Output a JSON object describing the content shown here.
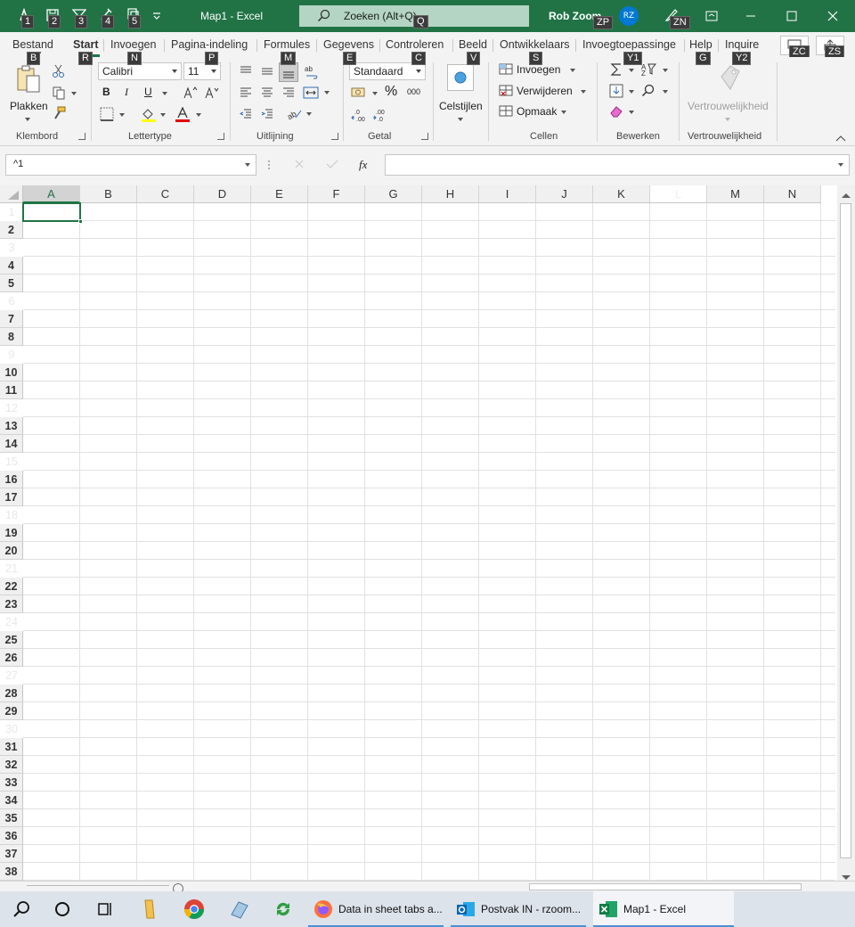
{
  "window": {
    "title": "Map1  -  Excel",
    "search_placeholder": "Zoeken (Alt+Q)",
    "user_name": "Rob Zoom",
    "avatar_initials": "RZ"
  },
  "keytips": {
    "qat": [
      "1",
      "2",
      "3",
      "4",
      "5"
    ],
    "search": "Q",
    "user": "ZP",
    "share": "ZN",
    "tabs": {
      "bestand": "B",
      "start": "R",
      "invoegen": "N",
      "pagina": "P",
      "formules": "M",
      "gegevens": "E",
      "controleren": "C",
      "beeld": "V",
      "ontwikkelaars": "S",
      "invoegtoepassingen": "Y1",
      "help": "G",
      "inquire": "Y2"
    },
    "right": [
      "ZC",
      "ZS"
    ]
  },
  "tabs": [
    "Bestand",
    "Start",
    "Invoegen",
    "Pagina-indeling",
    "Formules",
    "Gegevens",
    "Controleren",
    "Beeld",
    "Ontwikkelaars",
    "Invoegtoepassinge",
    "Help",
    "Inquire"
  ],
  "ribbon": {
    "clipboard": {
      "paste": "Plakken",
      "label": "Klembord"
    },
    "font": {
      "name": "Calibri",
      "size": "11",
      "bold": "B",
      "italic": "I",
      "underline": "U",
      "label": "Lettertype"
    },
    "alignment": {
      "label": "Uitlijning"
    },
    "number": {
      "format": "Standaard",
      "percent": "%",
      "thousands": "000",
      "label": "Getal"
    },
    "styles": {
      "cell_styles": "Celstijlen"
    },
    "cells": {
      "insert": "Invoegen",
      "delete": "Verwijderen",
      "format": "Opmaak",
      "label": "Cellen"
    },
    "editing": {
      "label": "Bewerken"
    },
    "sensitivity": {
      "button": "Vertrouwelijkheid",
      "label": "Vertrouwelijkheid"
    }
  },
  "formula_bar": {
    "name_box": "^1",
    "fx": "fx"
  },
  "grid": {
    "columns": [
      "A",
      "B",
      "C",
      "D",
      "E",
      "F",
      "G",
      "H",
      "I",
      "J",
      "K",
      "L",
      "M",
      "N"
    ],
    "selected_column": "A",
    "rows": [
      "1",
      "2",
      "3",
      "4",
      "5",
      "6",
      "7",
      "8",
      "9",
      "10",
      "11",
      "12",
      "13",
      "14",
      "15",
      "16",
      "17",
      "18",
      "19",
      "20",
      "21",
      "22",
      "23",
      "24",
      "25",
      "26",
      "27",
      "28",
      "29",
      "30",
      "31",
      "32",
      "33",
      "34",
      "35",
      "36",
      "37",
      "38"
    ],
    "faded_rows": [
      "1",
      "3",
      "6",
      "9",
      "12",
      "15",
      "18",
      "21",
      "24",
      "27",
      "30"
    ],
    "faded_columns": [
      "L"
    ]
  },
  "taskbar": {
    "apps": [
      {
        "label": "Data in sheet tabs a..."
      },
      {
        "label": "Postvak IN - rzoom..."
      },
      {
        "label": "Map1 - Excel"
      }
    ]
  },
  "colors": {
    "accent": "#217346",
    "avatar": "#0078d4"
  }
}
